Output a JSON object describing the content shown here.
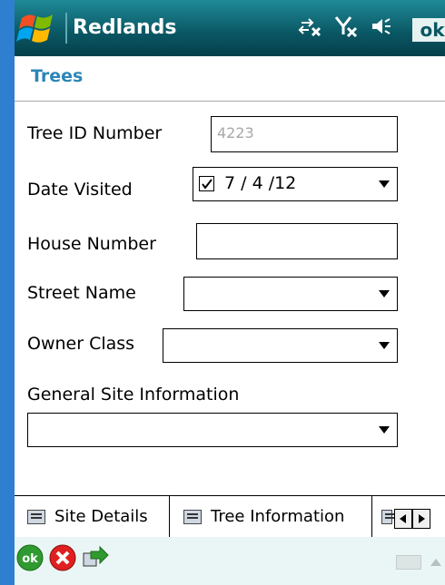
{
  "titlebar": {
    "title": "Redlands",
    "ok_label": "ok"
  },
  "page": {
    "heading": "Trees"
  },
  "form": {
    "tree_id": {
      "label": "Tree ID Number",
      "value": "4223"
    },
    "date_visited": {
      "label": "Date Visited",
      "value": "7 / 4 /12",
      "checked": true
    },
    "house_number": {
      "label": "House Number",
      "value": ""
    },
    "street_name": {
      "label": "Street Name",
      "value": ""
    },
    "owner_class": {
      "label": "Owner Class",
      "value": ""
    },
    "general_site_info": {
      "label": "General Site Information",
      "value": ""
    }
  },
  "tabs": [
    {
      "label": "Site Details",
      "selected": true
    },
    {
      "label": "Tree Information",
      "selected": false
    }
  ],
  "colors": {
    "titlebar": "#0a5663",
    "heading": "#2b86b5",
    "bottombar": "#eaf6f5"
  },
  "icons": {
    "start": "windows-flag-icon",
    "connectivity": "sync-arrows-icon",
    "signal": "signal-off-icon",
    "volume": "speaker-icon",
    "bottom_ok": "ok-circle-icon",
    "bottom_cancel": "cancel-circle-icon",
    "bottom_next": "forward-arrow-icon"
  }
}
